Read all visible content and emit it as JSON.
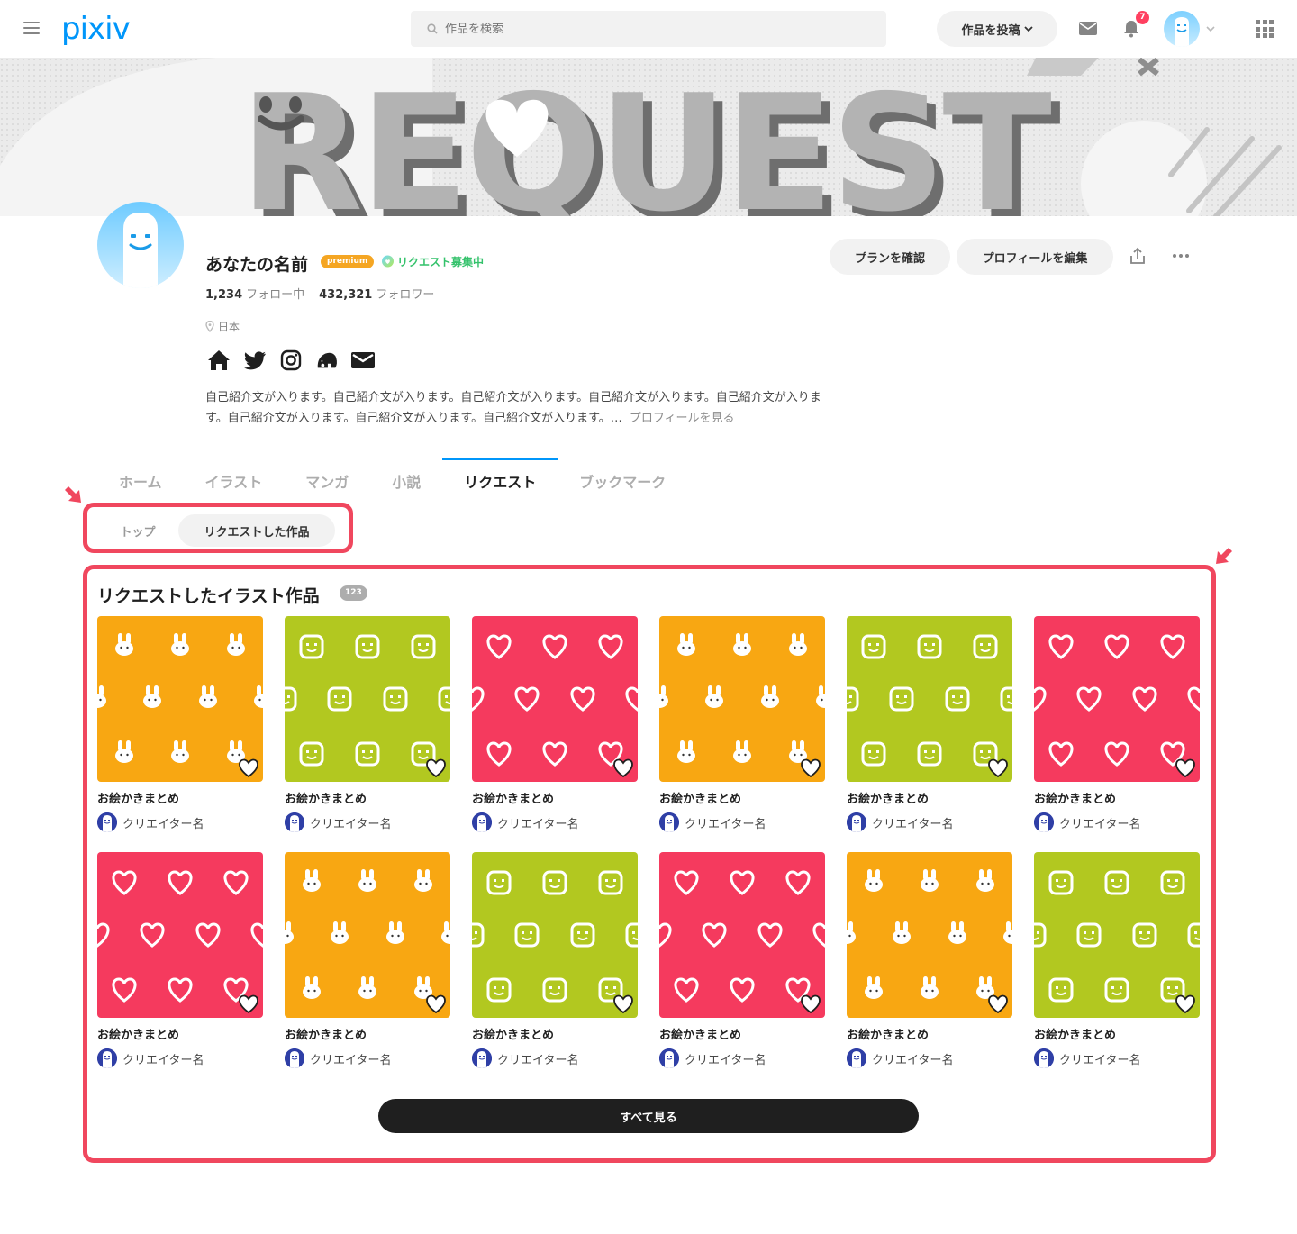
{
  "header": {
    "logo": "pixiv",
    "search_placeholder": "作品を検索",
    "post_button": "作品を投稿",
    "notification_count": "7",
    "icons": [
      "menu-icon",
      "search-icon",
      "mail-icon",
      "bell-icon",
      "apps-icon"
    ]
  },
  "profile": {
    "name": "あなたの名前",
    "premium_badge": "premium",
    "request_status": "リクエスト募集中",
    "following_count": "1,234",
    "following_label": "フォロー中",
    "followers_count": "432,321",
    "followers_label": "フォロワー",
    "location": "日本",
    "social_icons": [
      "home-icon",
      "twitter-icon",
      "instagram-icon",
      "mastodon-icon",
      "mail-icon"
    ],
    "bio": "自己紹介文が入ります。自己紹介文が入ります。自己紹介文が入ります。自己紹介文が入ります。自己紹介文が入ります。自己紹介文が入ります。自己紹介文が入ります。自己紹介文が入ります。…",
    "bio_more": "プロフィールを見る",
    "plan_button": "プランを確認",
    "edit_button": "プロフィールを編集"
  },
  "cover": {
    "text": "REQUEST"
  },
  "tabs": [
    {
      "label": "ホーム",
      "active": false
    },
    {
      "label": "イラスト",
      "active": false
    },
    {
      "label": "マンガ",
      "active": false
    },
    {
      "label": "小説",
      "active": false
    },
    {
      "label": "リクエスト",
      "active": true
    },
    {
      "label": "ブックマーク",
      "active": false
    }
  ],
  "subtabs": {
    "top": "トップ",
    "requested": "リクエストした作品"
  },
  "works": {
    "title": "リクエストしたイラスト作品",
    "count": "123",
    "see_all": "すべて見る",
    "colors": {
      "orange": "#f8a712",
      "green": "#b2c820",
      "red": "#f53a5e"
    },
    "items": [
      {
        "pattern": "bunny",
        "color": "orange",
        "title": "お絵かきまとめ",
        "creator": "クリエイター名"
      },
      {
        "pattern": "face",
        "color": "green",
        "title": "お絵かきまとめ",
        "creator": "クリエイター名"
      },
      {
        "pattern": "heart",
        "color": "red",
        "title": "お絵かきまとめ",
        "creator": "クリエイター名"
      },
      {
        "pattern": "bunny",
        "color": "orange",
        "title": "お絵かきまとめ",
        "creator": "クリエイター名"
      },
      {
        "pattern": "face",
        "color": "green",
        "title": "お絵かきまとめ",
        "creator": "クリエイター名"
      },
      {
        "pattern": "heart",
        "color": "red",
        "title": "お絵かきまとめ",
        "creator": "クリエイター名"
      },
      {
        "pattern": "heart",
        "color": "red",
        "title": "お絵かきまとめ",
        "creator": "クリエイター名"
      },
      {
        "pattern": "bunny",
        "color": "orange",
        "title": "お絵かきまとめ",
        "creator": "クリエイター名"
      },
      {
        "pattern": "face",
        "color": "green",
        "title": "お絵かきまとめ",
        "creator": "クリエイター名"
      },
      {
        "pattern": "heart",
        "color": "red",
        "title": "お絵かきまとめ",
        "creator": "クリエイター名"
      },
      {
        "pattern": "bunny",
        "color": "orange",
        "title": "お絵かきまとめ",
        "creator": "クリエイター名"
      },
      {
        "pattern": "face",
        "color": "green",
        "title": "お絵かきまとめ",
        "creator": "クリエイター名"
      }
    ]
  },
  "accent_colors": {
    "pixiv_blue": "#0096fa",
    "highlight_red": "#f0475e",
    "request_green": "#34c26b",
    "premium_orange": "#f5a623"
  }
}
